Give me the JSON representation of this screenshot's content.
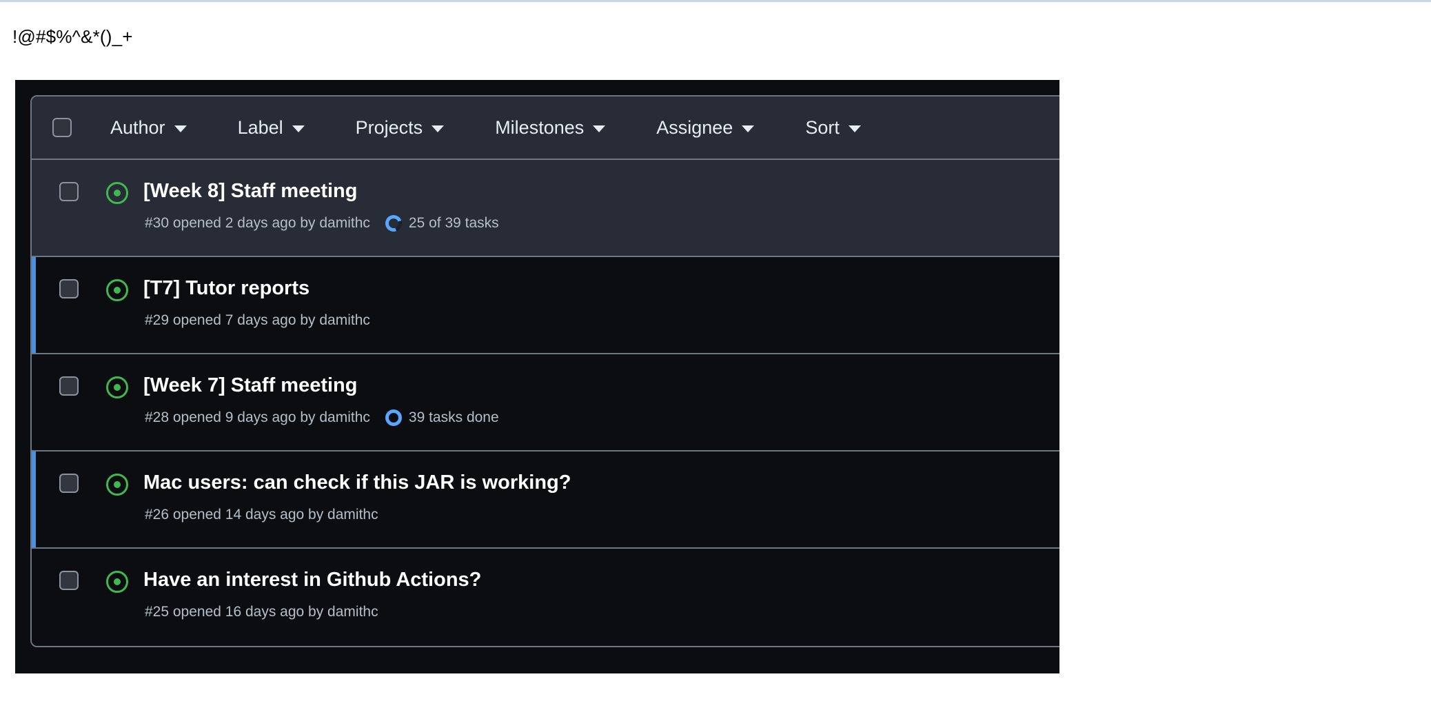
{
  "page": {
    "heading": "!@#$%^&*()_+"
  },
  "toolbar": {
    "select_all_checkbox": "select-all",
    "filters": [
      {
        "label": "Author"
      },
      {
        "label": "Label"
      },
      {
        "label": "Projects"
      },
      {
        "label": "Milestones"
      },
      {
        "label": "Assignee"
      },
      {
        "label": "Sort"
      }
    ]
  },
  "colors": {
    "open_issue_green": "#3fb950",
    "accent_blue": "#4b8fe0",
    "progress_blue": "#58a6ff",
    "panel_border": "#6e7681",
    "row_dark": "#0b0d11",
    "row_shaded": "#272c36"
  },
  "issues": [
    {
      "title": "[Week 8] Staff meeting",
      "meta": "#30 opened 2 days ago by damithc",
      "tasks_label": "25 of 39 tasks",
      "tasks_state": "partial",
      "icon": "issue-opened-icon",
      "shaded": true,
      "accent": false
    },
    {
      "title": "[T7] Tutor reports",
      "meta": "#29 opened 7 days ago by damithc",
      "tasks_label": "",
      "tasks_state": "none",
      "icon": "issue-opened-icon",
      "shaded": false,
      "accent": true
    },
    {
      "title": "[Week 7] Staff meeting",
      "meta": "#28 opened 9 days ago by damithc",
      "tasks_label": "39 tasks done",
      "tasks_state": "full",
      "icon": "issue-opened-icon",
      "shaded": false,
      "accent": false
    },
    {
      "title": "Mac users: can check if this JAR is working?",
      "meta": "#26 opened 14 days ago by damithc",
      "tasks_label": "",
      "tasks_state": "none",
      "icon": "issue-opened-icon",
      "shaded": false,
      "accent": true
    },
    {
      "title": "Have an interest in Github Actions?",
      "meta": "#25 opened 16 days ago by damithc",
      "tasks_label": "",
      "tasks_state": "none",
      "icon": "issue-opened-icon",
      "shaded": false,
      "accent": false
    }
  ]
}
